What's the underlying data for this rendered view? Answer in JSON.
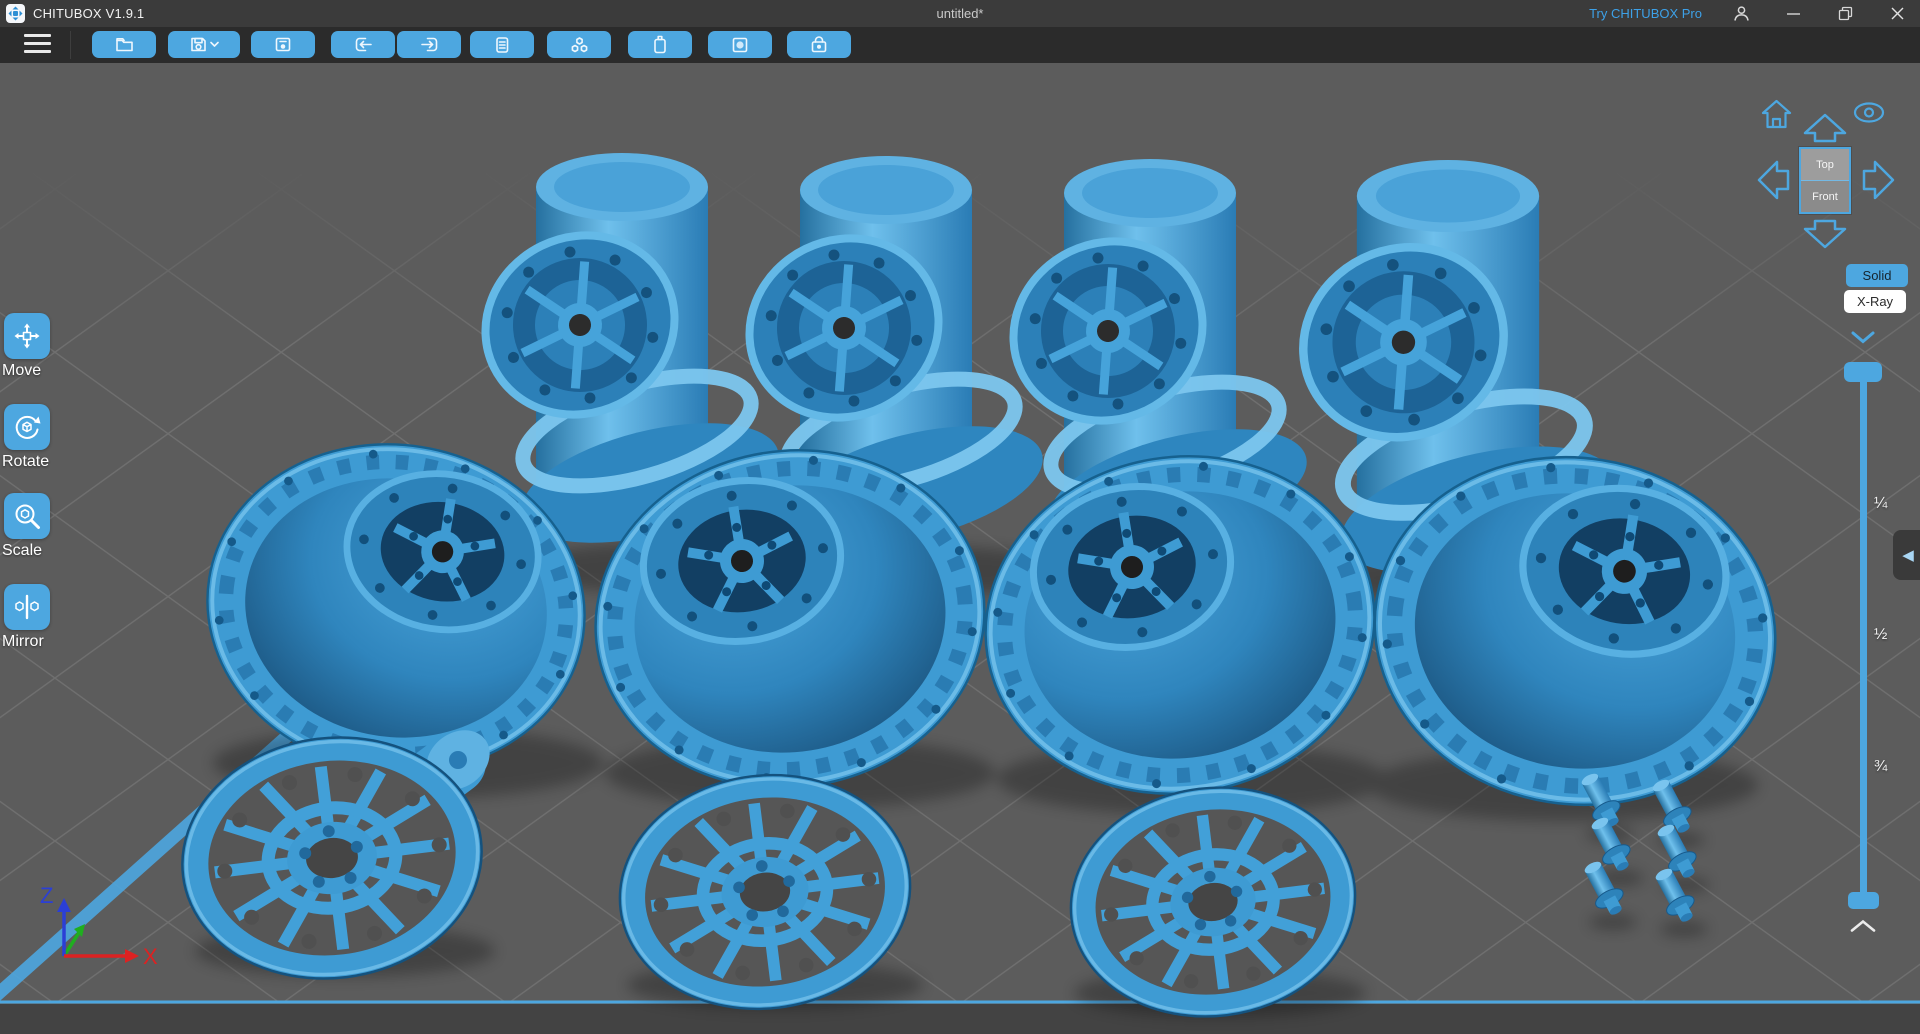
{
  "titlebar": {
    "logo_icon": "chitubox-logo",
    "app_title": "CHITUBOX V1.9.1",
    "document_title": "untitled*",
    "pro_link": "Try CHITUBOX Pro",
    "controls": [
      {
        "name": "account",
        "icon": "user-icon"
      },
      {
        "name": "minimize",
        "icon": "minimize-icon"
      },
      {
        "name": "restore",
        "icon": "restore-icon"
      },
      {
        "name": "close",
        "icon": "close-icon"
      }
    ]
  },
  "toolbar": {
    "menu_icon": "hamburger-menu-icon",
    "buttons": [
      {
        "name": "open-file",
        "icon": "folder-open-icon"
      },
      {
        "name": "save",
        "icon": "save-icon",
        "dropdown_icon": "chevron-down-icon"
      },
      {
        "name": "screenshot",
        "icon": "capture-frame-icon"
      },
      {
        "name": "undo",
        "icon": "undo-arrow-icon"
      },
      {
        "name": "redo",
        "icon": "redo-arrow-icon"
      },
      {
        "name": "clone",
        "icon": "copy-icon"
      },
      {
        "name": "auto-layout",
        "icon": "arrange-parts-icon"
      },
      {
        "name": "resin",
        "icon": "bottle-icon"
      },
      {
        "name": "hollow",
        "icon": "square-dot-icon"
      },
      {
        "name": "dig-hole",
        "icon": "box-circle-icon"
      }
    ]
  },
  "left_toolbar": {
    "tools": [
      {
        "label": "Move",
        "icon": "move-tool-icon"
      },
      {
        "label": "Rotate",
        "icon": "rotate-tool-icon"
      },
      {
        "label": "Scale",
        "icon": "scale-tool-icon"
      },
      {
        "label": "Mirror",
        "icon": "mirror-tool-icon"
      }
    ]
  },
  "view_controls": {
    "home_icon": "home-icon",
    "visibility_icon": "eye-icon",
    "nav_arrows": [
      "up",
      "left",
      "right",
      "down"
    ],
    "cube": {
      "top_face": "Top",
      "front_face": "Front"
    },
    "render_modes": [
      {
        "label": "Solid",
        "active": true
      },
      {
        "label": "X-Ray",
        "active": false
      }
    ],
    "collapse_icon": "chevron-down-icon"
  },
  "slice_slider": {
    "tick_labels": [
      "¼",
      "½",
      "¾"
    ],
    "scroll_up_icon": "chevron-up-icon",
    "panel_toggle_icon": "triangle-left-icon"
  },
  "axis_indicator": {
    "z_label": "Z",
    "x_label": "X"
  },
  "colors": {
    "accent_blue": "#4da7e0",
    "model_blue": "#3e9bd3",
    "titlebar_bg": "#3b3b3b",
    "toolbar_bg": "#2b2b2b",
    "viewport_bg": "#5c5c5c",
    "solid_active_bg": "#4da7e0",
    "xray_bg": "#ffffff"
  }
}
